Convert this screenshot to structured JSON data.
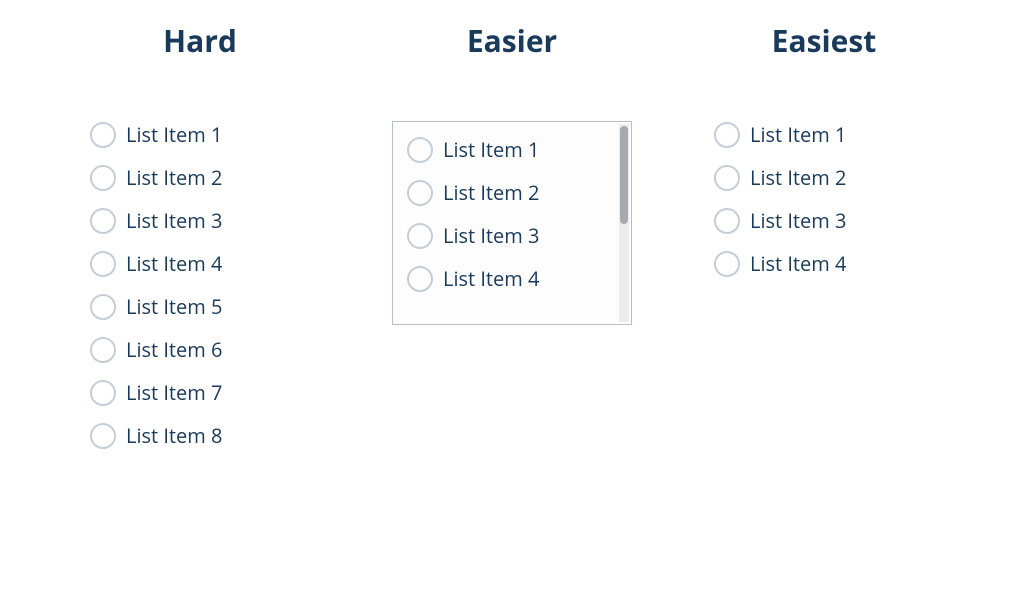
{
  "columns": {
    "hard": {
      "heading": "Hard",
      "items": [
        "List Item 1",
        "List Item 2",
        "List Item 3",
        "List Item 4",
        "List Item 5",
        "List Item 6",
        "List Item 7",
        "List Item 8"
      ]
    },
    "easier": {
      "heading": "Easier",
      "items": [
        "List Item 1",
        "List Item 2",
        "List Item 3",
        "List Item 4"
      ]
    },
    "easiest": {
      "heading": "Easiest",
      "items": [
        "List Item 1",
        "List Item 2",
        "List Item 3",
        "List Item 4"
      ]
    }
  }
}
